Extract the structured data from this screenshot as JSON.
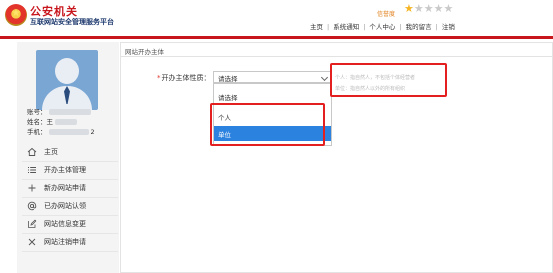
{
  "header": {
    "title": "公安机关",
    "subtitle": "互联网站安全管理服务平台",
    "rating_label": "信誉度",
    "rating": {
      "value": 1,
      "max": 5
    },
    "nav": [
      "主页",
      "系统通知",
      "个人中心",
      "我的留言",
      "注销"
    ]
  },
  "sidebar": {
    "user": {
      "account_label": "账号：",
      "account_value": "",
      "name_label": "姓名：",
      "name_value": "王",
      "phone_label": "手机：",
      "phone_value": "2"
    },
    "menu": [
      {
        "label": "主页",
        "icon": "home-icon"
      },
      {
        "label": "开办主体管理",
        "icon": "list-icon"
      },
      {
        "label": "新办网站申请",
        "icon": "plus-icon"
      },
      {
        "label": "已办网站认领",
        "icon": "at-icon"
      },
      {
        "label": "网站信息变更",
        "icon": "edit-icon"
      },
      {
        "label": "网站注销申请",
        "icon": "close-icon"
      }
    ]
  },
  "main": {
    "section_title": "网站开办主体",
    "field": {
      "label": "开办主体性质：",
      "selected": "请选择",
      "options": [
        "请选择",
        "个人",
        "单位"
      ],
      "highlighted": "单位"
    },
    "hints": [
      "个人：指自然人，不包括个体经营者",
      "单位：指自然人以外的所有组织"
    ]
  },
  "colors": {
    "brand_red": "#c8161d",
    "brand_blue": "#1e3a6e",
    "accent_blue": "#2c82df",
    "callout_red": "#e41f1f",
    "star_gold": "#f5b523"
  }
}
